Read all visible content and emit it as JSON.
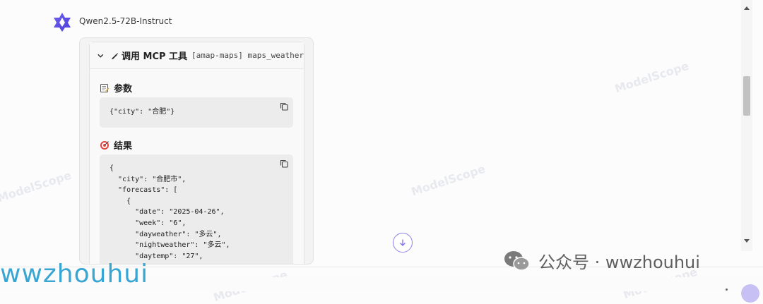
{
  "message": {
    "model_name": "Qwen2.5-72B-Instruct"
  },
  "tool_call": {
    "title": "调用 MCP 工具",
    "tool_name": "[amap-maps] maps_weather",
    "params_label": "参数",
    "params_code": "{\"city\": \"合肥\"}",
    "result_label": "结果",
    "result_lines": [
      "{",
      "  \"city\": \"合肥市\",",
      "  \"forecasts\": [",
      "    {",
      "      \"date\": \"2025-04-26\",",
      "      \"week\": \"6\",",
      "      \"dayweather\": \"多云\",",
      "      \"nightweather\": \"多云\",",
      "      \"daytemp\": \"27\","
    ]
  },
  "watermarks": [
    "ModelScope",
    "ModelScope",
    "ModelScope",
    "ModelScope",
    "ModelScope",
    "ModelScope",
    "ModelScope",
    "ModelScope"
  ],
  "branding": {
    "left_text": "wwzhouhui",
    "right_text": "公众号 · wwzhouhui"
  },
  "icons": {
    "avatar": "qwen-logo",
    "chevron": "chevron-down-icon",
    "pen": "pen-icon",
    "params": "memo-icon",
    "result": "target-icon",
    "copy": "copy-icon",
    "scroll_bottom": "arrow-down-icon",
    "wechat": "wechat-icon"
  },
  "colors": {
    "accent": "#7b6ee6",
    "brand_left": "#38a6d2",
    "scroll_thumb": "#c2c2c2"
  }
}
